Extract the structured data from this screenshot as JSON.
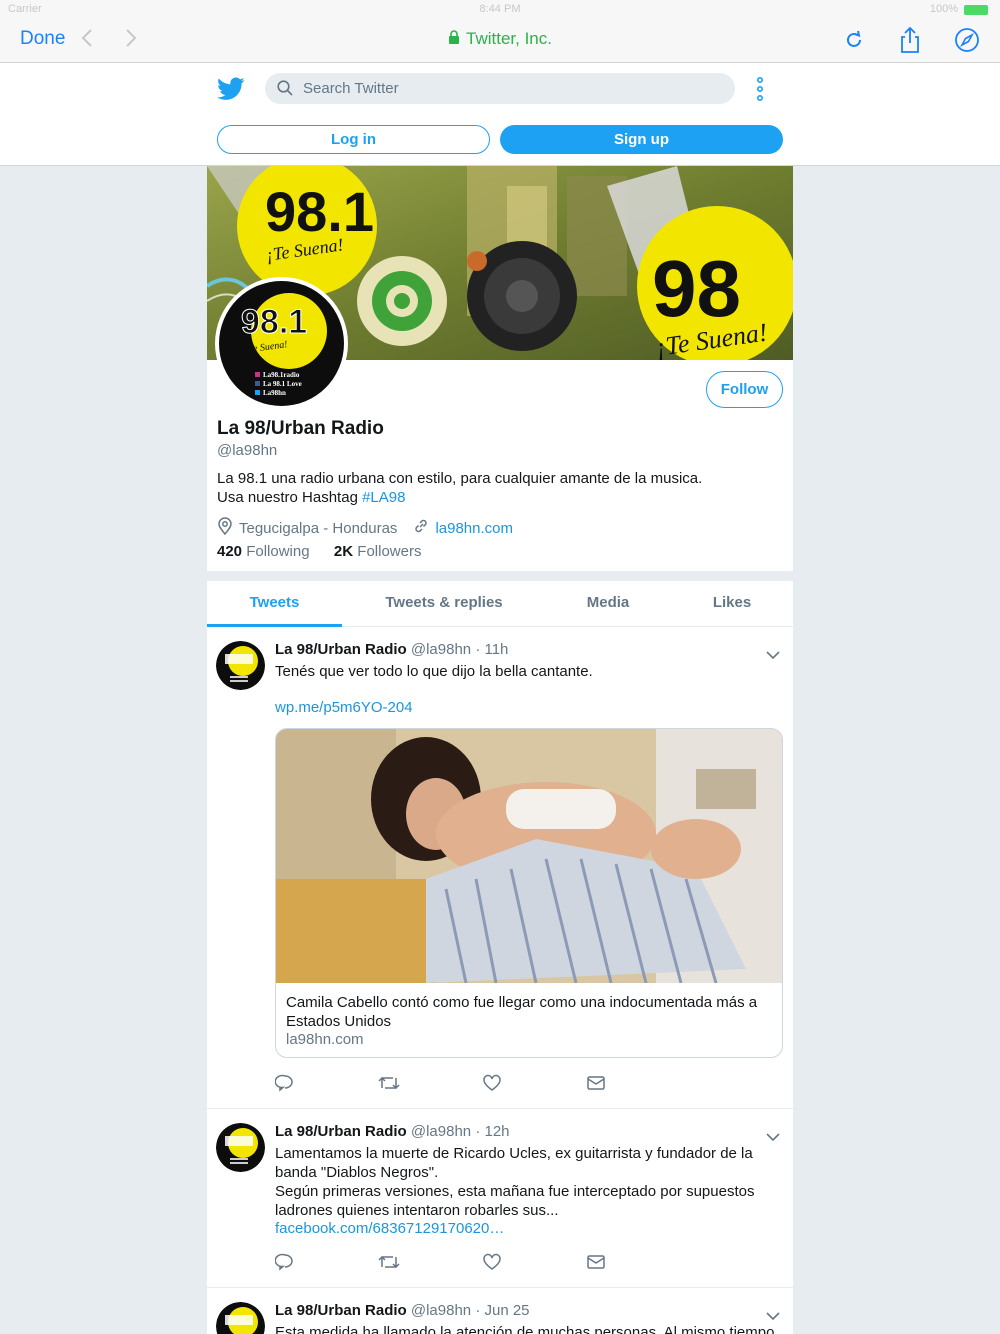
{
  "statusbar": {
    "carrier": "Carrier",
    "time": "8:44 PM",
    "battery": "100%"
  },
  "safari": {
    "done_label": "Done",
    "site_title": "Twitter, Inc."
  },
  "header": {
    "search_placeholder": "Search Twitter",
    "login_label": "Log in",
    "signup_label": "Sign up"
  },
  "profile": {
    "follow_label": "Follow",
    "name": "La 98/Urban Radio",
    "handle": "@la98hn",
    "bio_line1": "La 98.1 una radio urbana con estilo, para cualquier amante de la musica.",
    "bio_line2_prefix": "Usa nuestro Hashtag ",
    "bio_hashtag": "#LA98",
    "location": "Tegucigalpa - Honduras",
    "website": "la98hn.com",
    "following_count": "420",
    "following_label": "Following",
    "followers_count": "2K",
    "followers_label": "Followers",
    "banner_text": {
      "logo": "98.1",
      "slogan": "¡Te Suena!",
      "logo_right": "98",
      "slogan_right": "¡Te Suena!"
    },
    "avatar_text": {
      "logo": "98.1",
      "slogan": "¡Te Suena!",
      "social1": "La98.1radio",
      "social2": "La 98.1 Love",
      "social3": "La98hn"
    }
  },
  "tabs": [
    "Tweets",
    "Tweets & replies",
    "Media",
    "Likes"
  ],
  "tweets": [
    {
      "name": "La 98/Urban Radio",
      "handle": "@la98hn",
      "time": "· 11h",
      "text": "Tenés que ver todo lo que dijo la bella cantante.",
      "link": "wp.me/p5m6YO-204",
      "card_title": "Camila Cabello contó como fue llegar como una indocumentada más a Estados Unidos",
      "card_domain": "la98hn.com"
    },
    {
      "name": "La 98/Urban Radio",
      "handle": "@la98hn",
      "time": "· 12h",
      "text": "Lamentamos la muerte de Ricardo Ucles, ex guitarrista y fundador de la banda \"Diablos Negros\".",
      "text2": "Según primeras versiones, esta mañana fue interceptado por supuestos ladrones quienes intentaron robarles sus...",
      "link": "facebook.com/68367129170620…"
    },
    {
      "name": "La 98/Urban Radio",
      "handle": "@la98hn",
      "time": "· Jun 25",
      "text": "Esta medida ha llamado la atención de muchas personas. Al mismo tiempo"
    }
  ],
  "colors": {
    "twitter_blue": "#1da1f2",
    "link_blue": "#1b95e0",
    "safari_blue": "#1a82fb",
    "secure_green": "#2bb34a",
    "station_yellow": "#f2e600"
  }
}
